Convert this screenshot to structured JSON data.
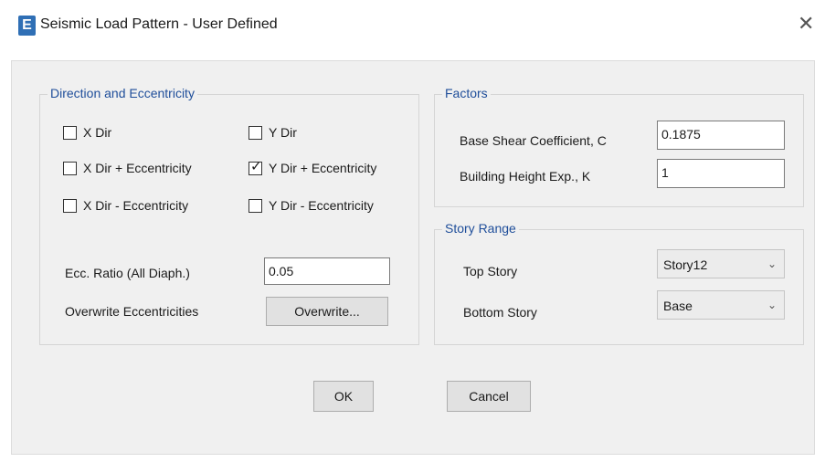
{
  "window": {
    "title": "Seismic Load Pattern - User Defined",
    "app_icon": "E",
    "close": "✕"
  },
  "direction": {
    "title": "Direction and Eccentricity",
    "options": [
      {
        "label": "X Dir",
        "checked": false
      },
      {
        "label": "Y Dir",
        "checked": false
      },
      {
        "label": "X Dir + Eccentricity",
        "checked": false
      },
      {
        "label": "Y Dir + Eccentricity",
        "checked": true
      },
      {
        "label": "X Dir - Eccentricity",
        "checked": false
      },
      {
        "label": "Y Dir - Eccentricity",
        "checked": false
      }
    ],
    "ecc_ratio_label": "Ecc. Ratio (All Diaph.)",
    "ecc_ratio_value": "0.05",
    "overwrite_label": "Overwrite Eccentricities",
    "overwrite_button": "Overwrite..."
  },
  "factors": {
    "title": "Factors",
    "base_shear_label": "Base Shear Coefficient, C",
    "base_shear_value": "0.1875",
    "height_exp_label": "Building Height Exp., K",
    "height_exp_value": "1"
  },
  "story_range": {
    "title": "Story Range",
    "top_label": "Top Story",
    "top_value": "Story12",
    "bottom_label": "Bottom Story",
    "bottom_value": "Base"
  },
  "buttons": {
    "ok": "OK",
    "cancel": "Cancel"
  },
  "check_mark": "✓",
  "chevron": "⌄"
}
